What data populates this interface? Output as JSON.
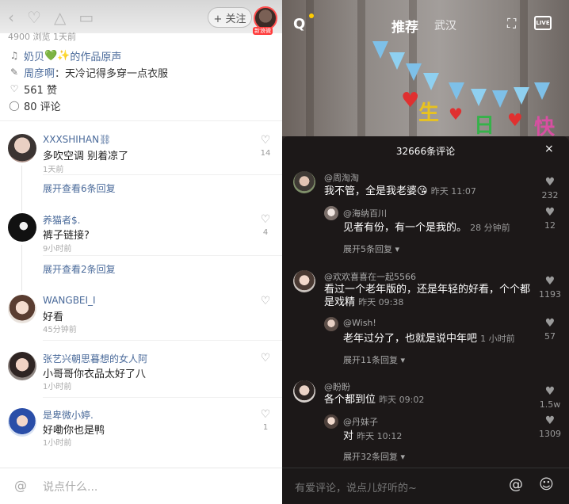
{
  "left": {
    "follow_label": "+ 关注",
    "avatar_badge": "新浪微",
    "views": "4900 浏览   1天前",
    "meta": {
      "music_user": "奶贝",
      "music_emoji": "💚✨",
      "music_suffix": "的作品原声",
      "desc_user": "周彦啊",
      "desc_text": "：天冷记得多穿一点衣服",
      "likes": "561 赞",
      "comments": "80 评论"
    },
    "comments": [
      {
        "name": "XXXSHIHAN⛓",
        "text": "多吹空调 别着凉了",
        "time": "1天前",
        "count": "14",
        "more": "展开查看6条回复"
      },
      {
        "name": "养猫者$.",
        "text": "裤子链接?",
        "time": "9小时前",
        "count": "4",
        "more": "展开查看2条回复"
      },
      {
        "name": "WANGBEI_I",
        "text": "好看",
        "time": "45分钟前",
        "count": "",
        "more": ""
      },
      {
        "name": "张艺兴朝思暮想的女人阿",
        "text": "小哥哥你衣品太好了八",
        "time": "1小时前",
        "count": "",
        "more": ""
      },
      {
        "name": "是卑微小婷.",
        "text": "好嘞你也是鸭",
        "time": "1小时前",
        "count": "1",
        "more": ""
      }
    ],
    "input_placeholder": "说点什么..."
  },
  "right": {
    "nav": {
      "tab": "推荐",
      "city": "武汉",
      "live": "LIVE"
    },
    "sheet_title": "32666条评论",
    "close": "×",
    "comments": [
      {
        "user": "@周淘淘",
        "text": "我不管，全是我老婆😘",
        "time": "昨天 11:07",
        "count": "232"
      },
      {
        "user": "@海纳百川",
        "text": "见者有份，有一个是我的。",
        "time": "28 分钟前",
        "count": "12"
      },
      {
        "expand": "展开5条回复 ▾"
      },
      {
        "user": "@欢欢喜喜在一起5566",
        "text1": "看过一个老年版的，还是年轻的好看，个个都",
        "text2": "是戏精",
        "time": "昨天 09:38",
        "count": "1193"
      },
      {
        "user": "@Wish!",
        "text": "老年过分了，也就是说中年吧",
        "time": "1 小时前",
        "count": "57"
      },
      {
        "expand": "展开11条回复 ▾"
      },
      {
        "user": "@盼盼",
        "text": "各个都到位",
        "time": "昨天 09:02",
        "count": "1.5w"
      },
      {
        "user": "@丹妹子",
        "text": "对",
        "time": "昨天 10:12",
        "count": "1309"
      },
      {
        "expand": "展开32条回复 ▾"
      }
    ],
    "input_placeholder": "有爱评论，说点儿好听的~"
  }
}
